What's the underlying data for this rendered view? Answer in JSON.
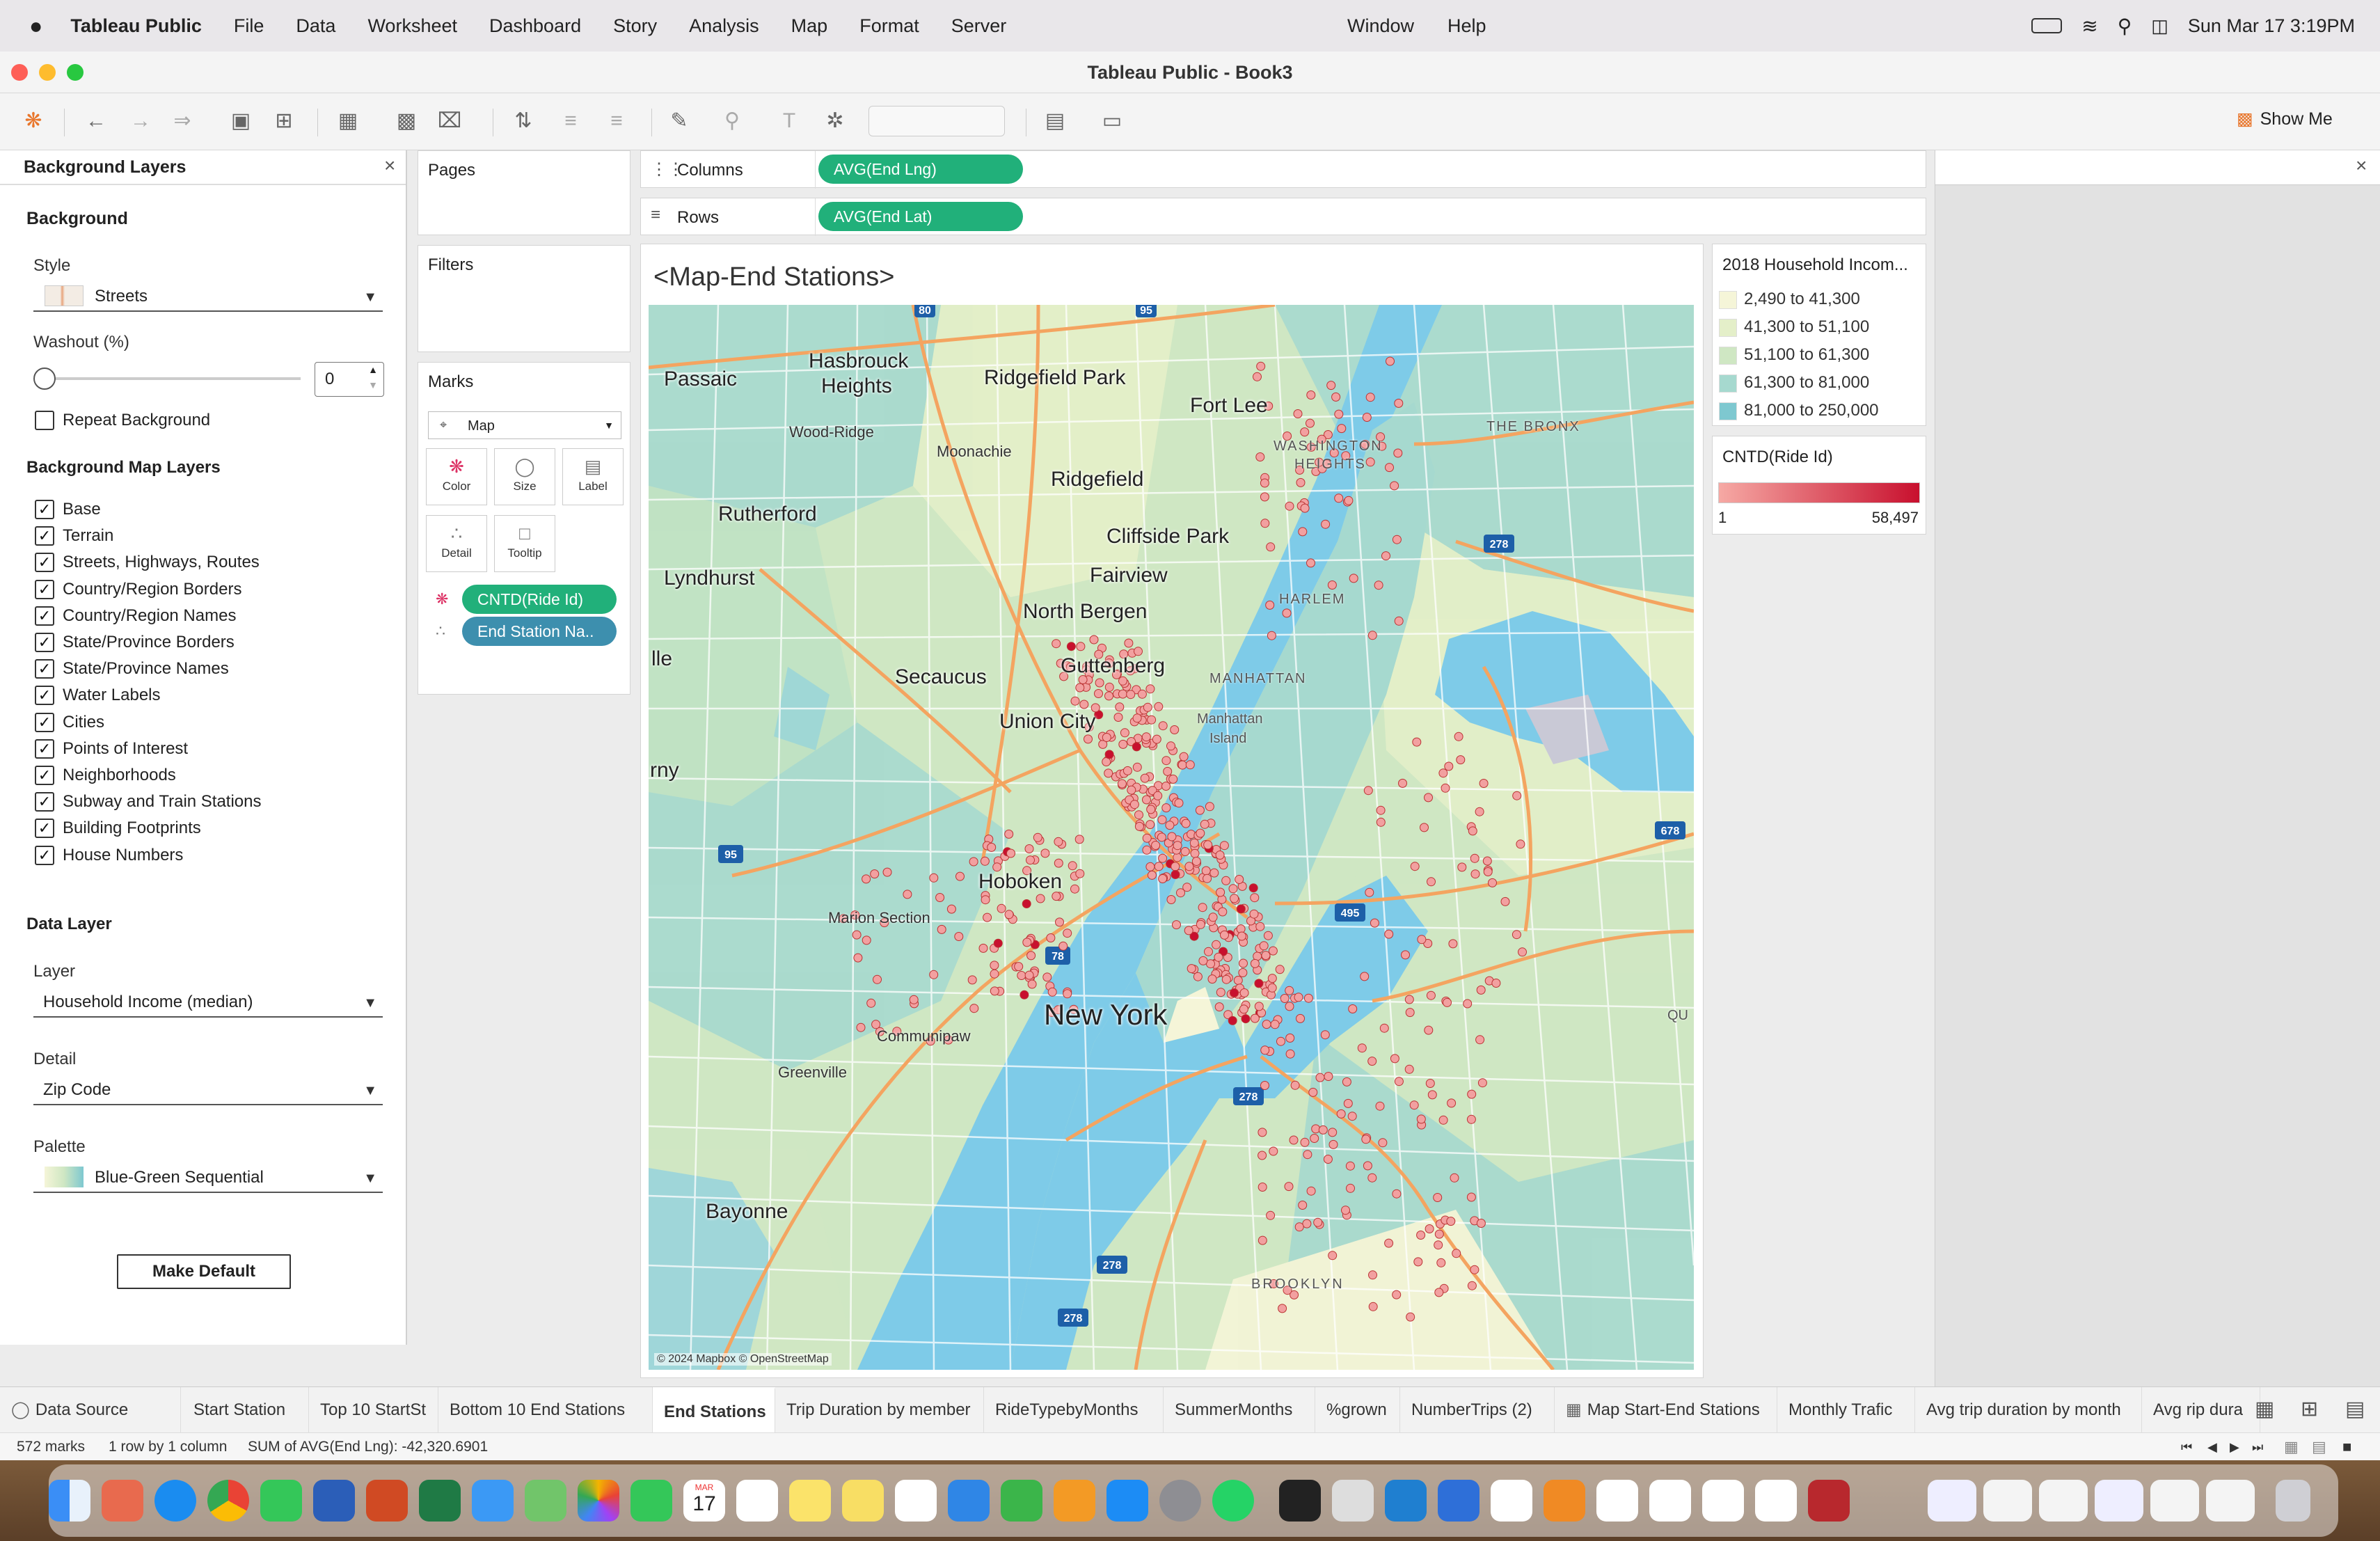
{
  "menubar": {
    "app": "Tableau Public",
    "items": [
      "File",
      "Data",
      "Worksheet",
      "Dashboard",
      "Story",
      "Analysis",
      "Map",
      "Format",
      "Server"
    ],
    "right_items": [
      "Window",
      "Help"
    ],
    "clock": "Sun Mar 17  3:19PM"
  },
  "window": {
    "title": "Tableau Public - Book3"
  },
  "toolbar": {
    "show_me": "Show Me"
  },
  "bg_panel": {
    "title": "Background Layers",
    "background_heading": "Background",
    "style_label": "Style",
    "style_value": "Streets",
    "washout_label": "Washout (%)",
    "washout_value": "0",
    "repeat_label": "Repeat Background",
    "map_layers_heading": "Background Map Layers",
    "layers": [
      "Base",
      "Terrain",
      "Streets, Highways, Routes",
      "Country/Region Borders",
      "Country/Region Names",
      "State/Province Borders",
      "State/Province Names",
      "Water Labels",
      "Cities",
      "Points of Interest",
      "Neighborhoods",
      "Subway and Train Stations",
      "Building Footprints",
      "House Numbers"
    ],
    "data_layer_heading": "Data Layer",
    "layer_label": "Layer",
    "layer_value": "Household Income (median)",
    "detail_label": "Detail",
    "detail_value": "Zip Code",
    "palette_label": "Palette",
    "palette_value": "Blue-Green Sequential",
    "make_default": "Make Default"
  },
  "shelves": {
    "pages": "Pages",
    "filters": "Filters",
    "marks": "Marks",
    "mark_type": "Map",
    "columns_label": "Columns",
    "columns_pill": "AVG(End Lng)",
    "rows_label": "Rows",
    "rows_pill": "AVG(End Lat)"
  },
  "marks_buttons": {
    "color": "Color",
    "size": "Size",
    "label": "Label",
    "detail": "Detail",
    "tooltip": "Tooltip"
  },
  "marks_pills": {
    "color_field": "CNTD(Ride Id)",
    "detail_field": "End Station Na.."
  },
  "view": {
    "title": "<Map-End Stations>",
    "attribution": "© 2024 Mapbox © OpenStreetMap"
  },
  "map_labels": {
    "passaic": "Passaic",
    "hasbrouck": "Hasbrouck",
    "heights": "Heights",
    "ridgefield_park": "Ridgefield Park",
    "fort_lee": "Fort Lee",
    "wood_ridge": "Wood-Ridge",
    "moonachie": "Moonachie",
    "ridgefield": "Ridgefield",
    "rutherford": "Rutherford",
    "cliffside": "Cliffside Park",
    "fairview": "Fairview",
    "lyndhurst": "Lyndhurst",
    "north_bergen": "North Bergen",
    "secaucus": "Secaucus",
    "guttenberg": "Guttenberg",
    "union_city": "Union City",
    "hoboken": "Hoboken",
    "marion": "Marion Section",
    "new_york": "New York",
    "communipaw": "Communipaw",
    "greenville": "Greenville",
    "bayonne": "Bayonne",
    "washington": "WASHINGTON",
    "heights2": "HEIGHTS",
    "bronx": "THE BRONX",
    "harlem": "HARLEM",
    "manhattan": "MANHATTAN",
    "manhattan_island1": "Manhattan",
    "manhattan_island2": "Island",
    "brooklyn": "BROOKLYN",
    "ile": "lle",
    "rny": "rny",
    "qu": "QU"
  },
  "routes": [
    "80",
    "95",
    "278",
    "95",
    "78",
    "495",
    "678",
    "278",
    "278",
    "278"
  ],
  "legend_income": {
    "title": "2018 Household Incom...",
    "rows": [
      {
        "label": "2,490 to 41,300",
        "color": "#f5f5d8"
      },
      {
        "label": "41,300 to 51,100",
        "color": "#e4efc9"
      },
      {
        "label": "51,100 to 61,300",
        "color": "#cfe7c3"
      },
      {
        "label": "61,300 to 81,000",
        "color": "#a6d9cf"
      },
      {
        "label": "81,000 to 250,000",
        "color": "#7ec8d0"
      }
    ]
  },
  "legend_cntd": {
    "title": "CNTD(Ride Id)",
    "min": "1",
    "max": "58,497",
    "color_start": "#f6a9a4",
    "color_end": "#c8102e"
  },
  "tabs": [
    "Data Source",
    "Start Station",
    "Top 10 StartSt",
    "Bottom 10 End Stations",
    "End Stations",
    "Trip Duration by member",
    "RideTypebyMonths",
    "SummerMonths",
    "%grown",
    "NumberTrips (2)",
    "Map Start-End Stations",
    "Monthly Trafic",
    "Avg trip duration by month",
    "Avg rip dura"
  ],
  "active_tab": "End Stations",
  "status": {
    "marks": "572 marks",
    "rows": "1 row by 1 column",
    "sum": "SUM of AVG(End Lng): -42,320.6901"
  },
  "dock": {
    "calendar_month": "MAR",
    "calendar_day": "17"
  }
}
